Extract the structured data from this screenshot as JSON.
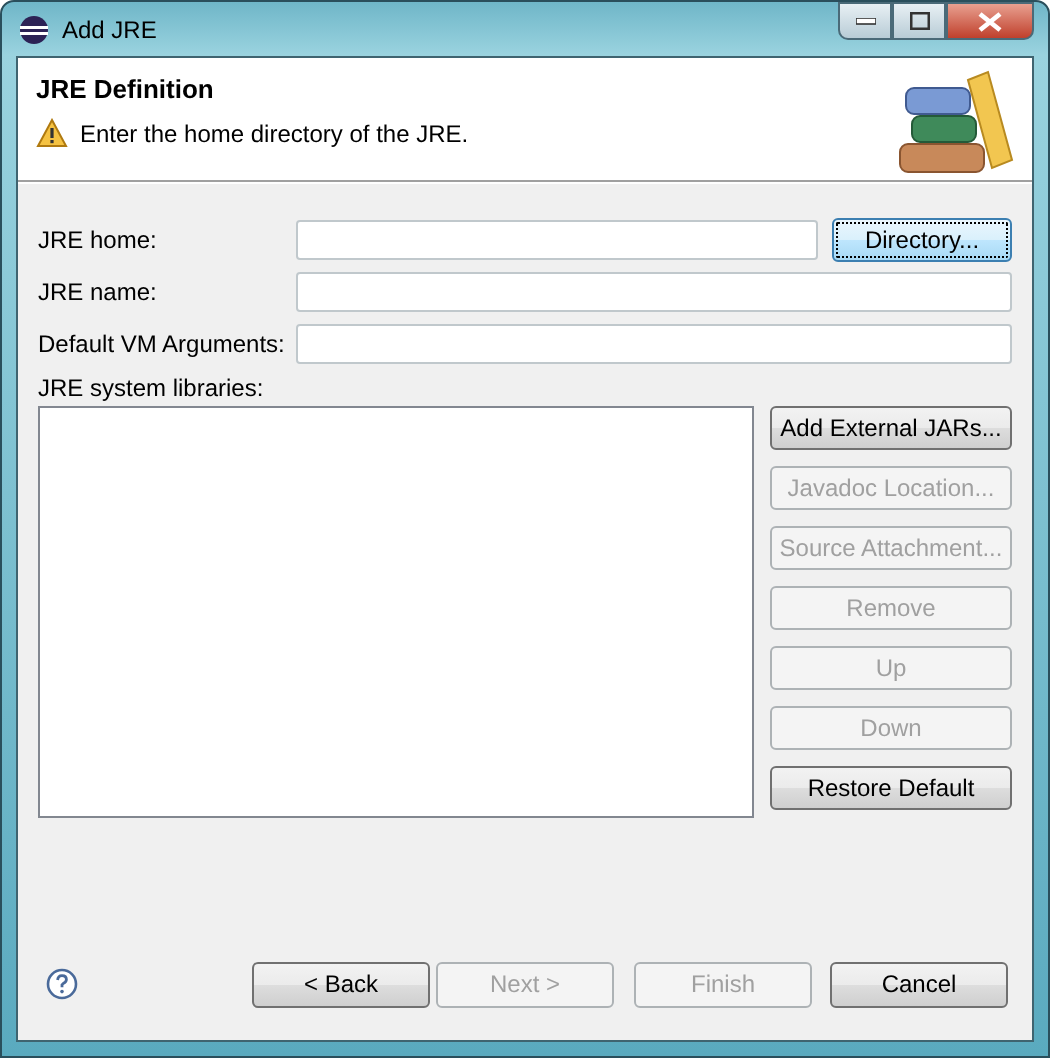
{
  "window": {
    "title": "Add JRE"
  },
  "header": {
    "title": "JRE Definition",
    "message": "Enter the home directory of the JRE."
  },
  "fields": [
    {
      "label": "JRE home:",
      "button": {
        "label": "Directory...",
        "focused": true
      }
    },
    {
      "label": "JRE name:"
    },
    {
      "label": "Default VM Arguments:"
    }
  ],
  "libraries": {
    "label": "JRE system libraries:"
  },
  "side_buttons": [
    {
      "label": "Add External JARs...",
      "disabled": false
    },
    {
      "label": "Javadoc Location...",
      "disabled": true
    },
    {
      "label": "Source Attachment...",
      "disabled": true
    },
    {
      "label": "Remove",
      "disabled": true
    },
    {
      "label": "Up",
      "disabled": true
    },
    {
      "label": "Down",
      "disabled": true
    },
    {
      "label": "Restore Default",
      "disabled": false
    }
  ],
  "footer_buttons": [
    {
      "label": "< Back",
      "disabled": false
    },
    {
      "label": "Next >",
      "disabled": true
    },
    {
      "label": "Finish",
      "disabled": true
    },
    {
      "label": "Cancel",
      "disabled": false
    }
  ]
}
